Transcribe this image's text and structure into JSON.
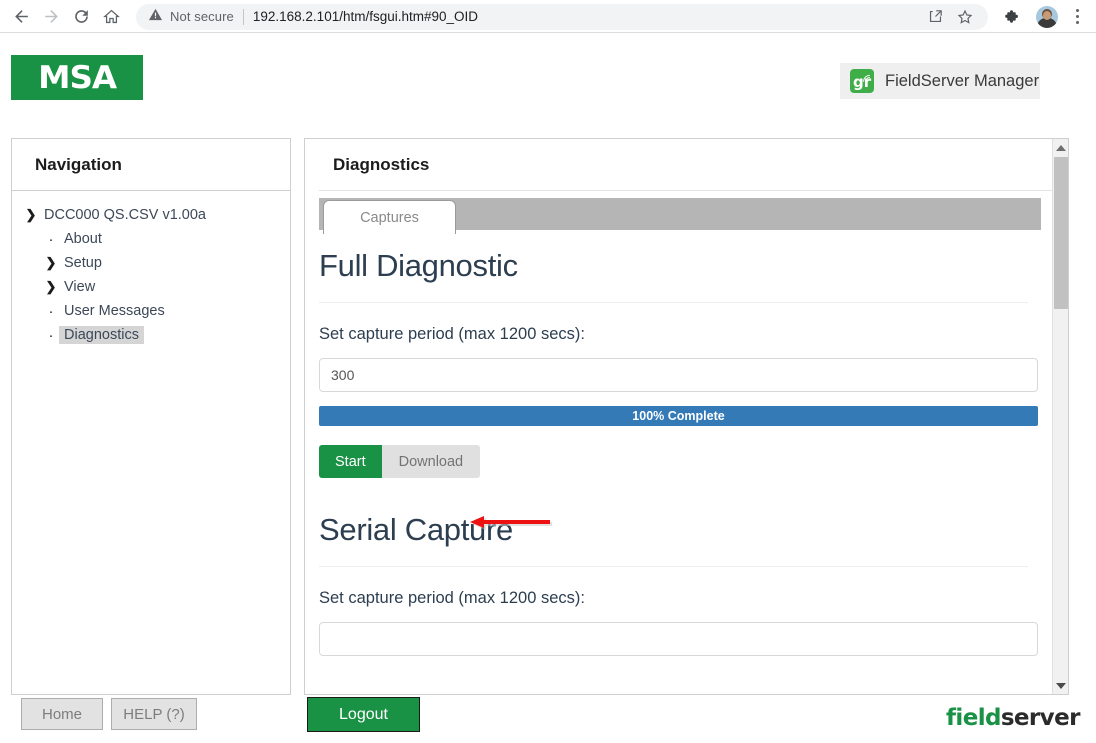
{
  "browser": {
    "back_icon": "back-arrow-icon",
    "forward_icon": "forward-arrow-icon",
    "reload_icon": "reload-icon",
    "home_icon": "home-icon",
    "security_label": "Not secure",
    "url": "192.168.2.101/htm/fsgui.htm#90_OID",
    "share_icon": "share-icon",
    "bookmark_icon": "star-icon",
    "extensions_icon": "puzzle-piece-icon",
    "profile_icon": "avatar",
    "menu_icon": "kebab-menu-icon"
  },
  "header": {
    "brand": "MSA",
    "manager_button": "FieldServer Manager",
    "manager_icon_text": "gr"
  },
  "sidebar": {
    "title": "Navigation",
    "items": [
      {
        "label": "DCC000 QS.CSV v1.00a",
        "marker": "chevron-down",
        "level": "root",
        "selected": false
      },
      {
        "label": "About",
        "marker": "dot",
        "level": "child",
        "selected": false
      },
      {
        "label": "Setup",
        "marker": "chevron-right",
        "level": "child",
        "selected": false
      },
      {
        "label": "View",
        "marker": "chevron-right",
        "level": "child",
        "selected": false
      },
      {
        "label": "User Messages",
        "marker": "dot",
        "level": "child",
        "selected": false
      },
      {
        "label": "Diagnostics",
        "marker": "dot",
        "level": "child",
        "selected": true
      }
    ]
  },
  "content": {
    "title": "Diagnostics",
    "tabs": [
      {
        "label": "Captures",
        "active": true
      }
    ],
    "sections": [
      {
        "heading": "Full Diagnostic",
        "field_label": "Set capture period (max 1200 secs):",
        "input_value": "300",
        "progress_label": "100% Complete",
        "progress_percent": 100,
        "progress_color": "#337ab7",
        "start_label": "Start",
        "download_label": "Download"
      },
      {
        "heading": "Serial Capture",
        "field_label": "Set capture period (max 1200 secs):",
        "input_value": ""
      }
    ]
  },
  "annotation": {
    "arrow_color": "#ee1111",
    "points_to": "Download"
  },
  "footer": {
    "home_label": "Home",
    "help_label": "HELP (?)",
    "logout_label": "Logout",
    "logo_part1": "field",
    "logo_part2": "server"
  },
  "colors": {
    "brand_green": "#1a9245",
    "progress_blue": "#337ab7",
    "tabbar_gray": "#b5b5b5"
  }
}
